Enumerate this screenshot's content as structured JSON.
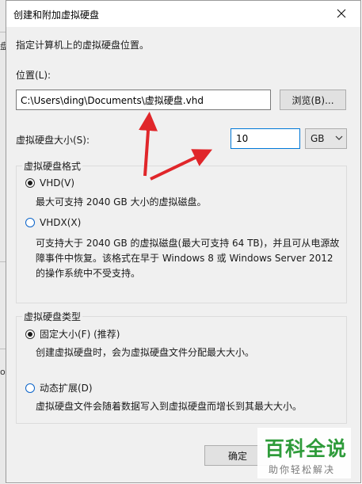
{
  "window": {
    "title": "创建和附加虚拟硬盘"
  },
  "intro_text": "指定计算机上的虚拟硬盘位置。",
  "location": {
    "label": "位置(L):",
    "value": "C:\\Users\\ding\\Documents\\虚拟硬盘.vhd",
    "browse_label": "浏览(B)..."
  },
  "size": {
    "label": "虚拟硬盘大小(S):",
    "value": "10",
    "unit": "GB"
  },
  "format_group": {
    "title": "虚拟硬盘格式",
    "options": [
      {
        "label": "VHD(V)",
        "selected": true,
        "desc": "最大可支持 2040 GB 大小的虚拟磁盘。"
      },
      {
        "label": "VHDX(X)",
        "selected": false,
        "desc_lines": [
          "可支持大于 2040 GB 的虚拟磁盘(最大可支持 64 TB)，并且可从电源故",
          "障事件中恢复。该格式在早于 Windows 8 或 Windows Server 2012",
          "的操作系统中不受支持。"
        ]
      }
    ]
  },
  "type_group": {
    "title": "虚拟硬盘类型",
    "options": [
      {
        "label": "固定大小(F) (推荐)",
        "selected": true,
        "desc": "创建虚拟硬盘时，会为虚拟硬盘文件分配最大大小。"
      },
      {
        "label": "动态扩展(D)",
        "selected": false,
        "desc": "虚拟硬盘文件会随着数据写入到虚拟硬盘而增长到其最大大小。"
      }
    ]
  },
  "footer": {
    "ok_label": "确定"
  },
  "background": {
    "glyph_a": "盘",
    "glyph_b": "o"
  },
  "watermark": {
    "main": "百科全说",
    "sub": "助你轻松解决"
  },
  "colors": {
    "accent": "#0078d7",
    "arrow": "#e0262a",
    "watermark_green": "#2e9b3a"
  }
}
